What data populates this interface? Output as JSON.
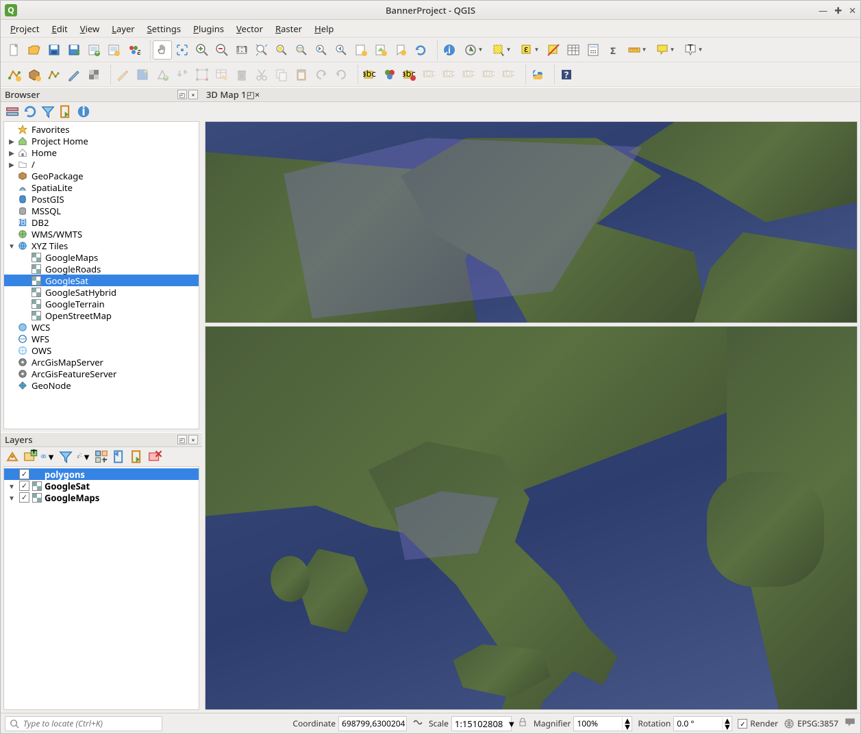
{
  "title": "BannerProject - QGIS",
  "menu": [
    "Project",
    "Edit",
    "View",
    "Layer",
    "Settings",
    "Plugins",
    "Vector",
    "Raster",
    "Help"
  ],
  "menu_ul": [
    "P",
    "E",
    "V",
    "L",
    "S",
    "P",
    "V",
    "R",
    "H"
  ],
  "panels": {
    "browser": {
      "title": "Browser"
    },
    "map3d": {
      "title": "3D Map 1"
    },
    "layers": {
      "title": "Layers"
    }
  },
  "browser_tree": [
    {
      "depth": 0,
      "exp": "",
      "icon": "star",
      "label": "Favorites"
    },
    {
      "depth": 0,
      "exp": "▶",
      "icon": "home-green",
      "label": "Project Home"
    },
    {
      "depth": 0,
      "exp": "▶",
      "icon": "home",
      "label": "Home"
    },
    {
      "depth": 0,
      "exp": "▶",
      "icon": "folder",
      "label": "/"
    },
    {
      "depth": 0,
      "exp": "",
      "icon": "geopkg",
      "label": "GeoPackage"
    },
    {
      "depth": 0,
      "exp": "",
      "icon": "spatialite",
      "label": "SpatiaLite"
    },
    {
      "depth": 0,
      "exp": "",
      "icon": "postgis",
      "label": "PostGIS"
    },
    {
      "depth": 0,
      "exp": "",
      "icon": "mssql",
      "label": "MSSQL"
    },
    {
      "depth": 0,
      "exp": "",
      "icon": "db2",
      "label": "DB2"
    },
    {
      "depth": 0,
      "exp": "",
      "icon": "wms",
      "label": "WMS/WMTS"
    },
    {
      "depth": 0,
      "exp": "▼",
      "icon": "globe",
      "label": "XYZ Tiles"
    },
    {
      "depth": 1,
      "exp": "",
      "icon": "xyz",
      "label": "GoogleMaps"
    },
    {
      "depth": 1,
      "exp": "",
      "icon": "xyz",
      "label": "GoogleRoads"
    },
    {
      "depth": 1,
      "exp": "",
      "icon": "xyz",
      "label": "GoogleSat",
      "selected": true
    },
    {
      "depth": 1,
      "exp": "",
      "icon": "xyz",
      "label": "GoogleSatHybrid"
    },
    {
      "depth": 1,
      "exp": "",
      "icon": "xyz",
      "label": "GoogleTerrain"
    },
    {
      "depth": 1,
      "exp": "",
      "icon": "xyz",
      "label": "OpenStreetMap"
    },
    {
      "depth": 0,
      "exp": "",
      "icon": "wcs",
      "label": "WCS"
    },
    {
      "depth": 0,
      "exp": "",
      "icon": "wfs",
      "label": "WFS"
    },
    {
      "depth": 0,
      "exp": "",
      "icon": "ows",
      "label": "OWS"
    },
    {
      "depth": 0,
      "exp": "",
      "icon": "arcgis",
      "label": "ArcGisMapServer"
    },
    {
      "depth": 0,
      "exp": "",
      "icon": "arcgis",
      "label": "ArcGisFeatureServer"
    },
    {
      "depth": 0,
      "exp": "",
      "icon": "geonode",
      "label": "GeoNode"
    }
  ],
  "layers": [
    {
      "exp": "",
      "checked": true,
      "swatch": "none",
      "label": "polygons",
      "selected": true
    },
    {
      "exp": "▼",
      "checked": true,
      "swatch": "xyz",
      "label": "GoogleSat"
    },
    {
      "exp": "▼",
      "checked": true,
      "swatch": "xyz",
      "label": "GoogleMaps"
    }
  ],
  "status": {
    "locator_placeholder": "Type to locate (Ctrl+K)",
    "coordinate_label": "Coordinate",
    "coordinate": "698799,6300204",
    "scale_label": "Scale",
    "scale": "1:15102808",
    "magnifier_label": "Magnifier",
    "magnifier": "100%",
    "rotation_label": "Rotation",
    "rotation": "0.0 °",
    "render_label": "Render",
    "crs": "EPSG:3857"
  },
  "colors": {
    "selection": "#3584e4",
    "panel_bg": "#f0eeec"
  }
}
